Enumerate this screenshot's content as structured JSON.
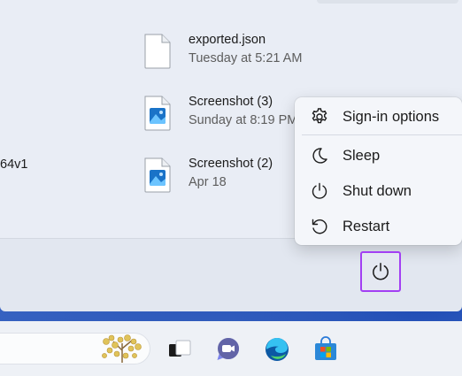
{
  "recent": {
    "items": [
      {
        "name": "exported.json",
        "date": "Tuesday at 5:21 AM",
        "icon": "document-file-icon"
      },
      {
        "name": "Screenshot (3)",
        "date": "Sunday at 8:19 PM",
        "icon": "image-file-icon"
      },
      {
        "name": "Screenshot (2)",
        "date": "Apr 18",
        "icon": "image-file-icon"
      }
    ],
    "cut_off_text": "64v1"
  },
  "power_menu": {
    "items": [
      {
        "label": "Sign-in options",
        "icon": "gear-icon"
      },
      {
        "label": "Sleep",
        "icon": "moon-icon"
      },
      {
        "label": "Shut down",
        "icon": "power-icon"
      },
      {
        "label": "Restart",
        "icon": "restart-icon"
      }
    ]
  },
  "power_button": {
    "icon": "power-icon",
    "highlight_color": "#a23ff3"
  },
  "taskbar": {
    "icons": [
      "search-highlight-icon",
      "task-view-icon",
      "teams-chat-icon",
      "edge-icon",
      "microsoft-store-icon"
    ]
  },
  "colors": {
    "accent": "#a23ff3",
    "panel": "#e9edf5",
    "menu": "#f4f6fa",
    "image_icon_blue": "#1a73c8"
  }
}
